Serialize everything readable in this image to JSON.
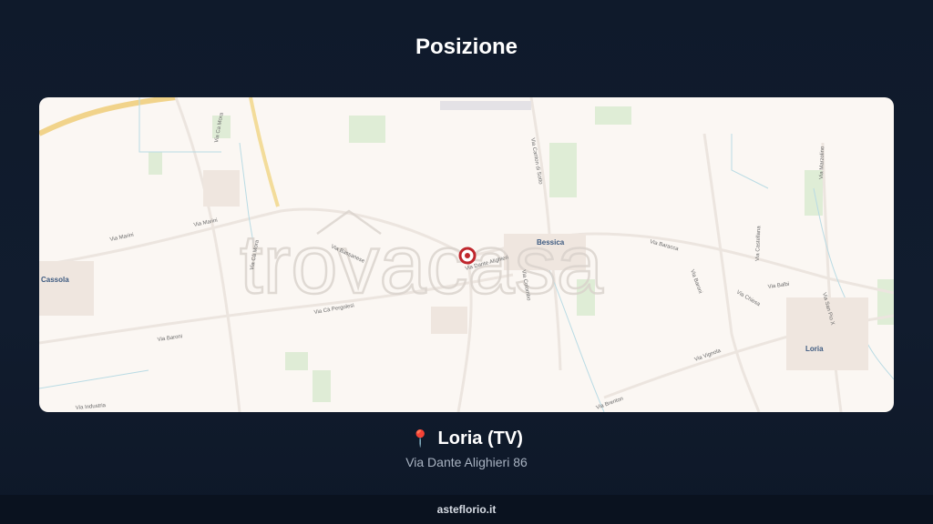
{
  "header": {
    "title": "Posizione"
  },
  "map": {
    "watermark": "trovacasa",
    "towns": [
      "Cassola",
      "Bessica",
      "Loria"
    ],
    "streets": [
      "Via Ca Mora",
      "Via Marini",
      "Via Marini",
      "Via Bassanese",
      "Via Dante Alighieri",
      "Via Baracca",
      "Via Baroni",
      "Via Balbi",
      "Via Cà Pergolesi",
      "Via Baroni",
      "Via Cà Mora",
      "Via Castellana",
      "Via Chiesa",
      "Via Vignola",
      "Via Brenton",
      "Via San Pio X",
      "Via Marzolino",
      "Via Canton di Sotto",
      "Via Colombo",
      "Via Industria"
    ]
  },
  "location": {
    "pin_icon": "📍",
    "title": "Loria (TV)",
    "address": "Via Dante Alighieri 86"
  },
  "footer": {
    "brand": "asteflorio.it"
  },
  "colors": {
    "background": "#0f1a2b",
    "map_base": "#fbf7f3",
    "marker": "#c0272d",
    "pin": "#e23b5a",
    "footer_bg": "#0a121f"
  }
}
